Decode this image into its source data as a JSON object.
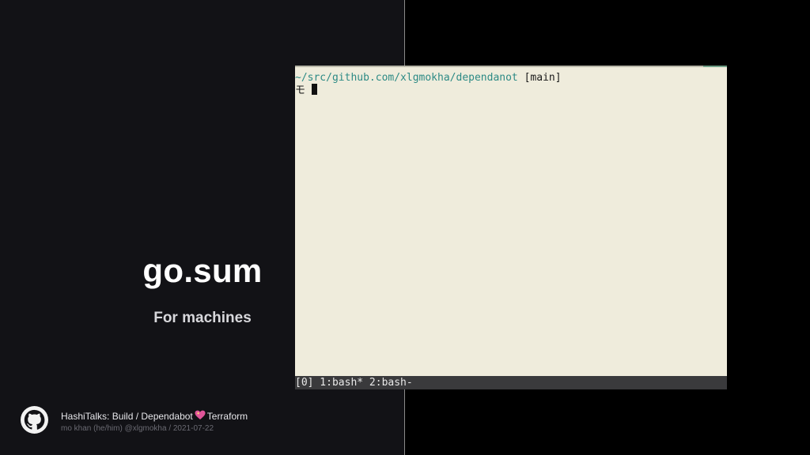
{
  "slide": {
    "title": "go.sum",
    "subtitle": "For machines"
  },
  "terminal": {
    "path": "~/src/github.com/xlgmokha/dependanot",
    "branch": "[main]",
    "prompt_char": "モ",
    "status_bar": "[0] 1:bash* 2:bash-"
  },
  "footer": {
    "icon": "github-icon",
    "talk_prefix": "HashiTalks: Build / Dependabot",
    "heart_icon": "sparkling-heart-icon",
    "talk_suffix": "Terraform",
    "meta": "mo khan (he/him) @xlgmokha / 2021-07-22"
  },
  "colors": {
    "left_background": "#121216",
    "terminal_background": "#efecdc",
    "terminal_path": "#2c8a85",
    "status_bar": "#3a3a3c",
    "heart": "#e0559a"
  }
}
